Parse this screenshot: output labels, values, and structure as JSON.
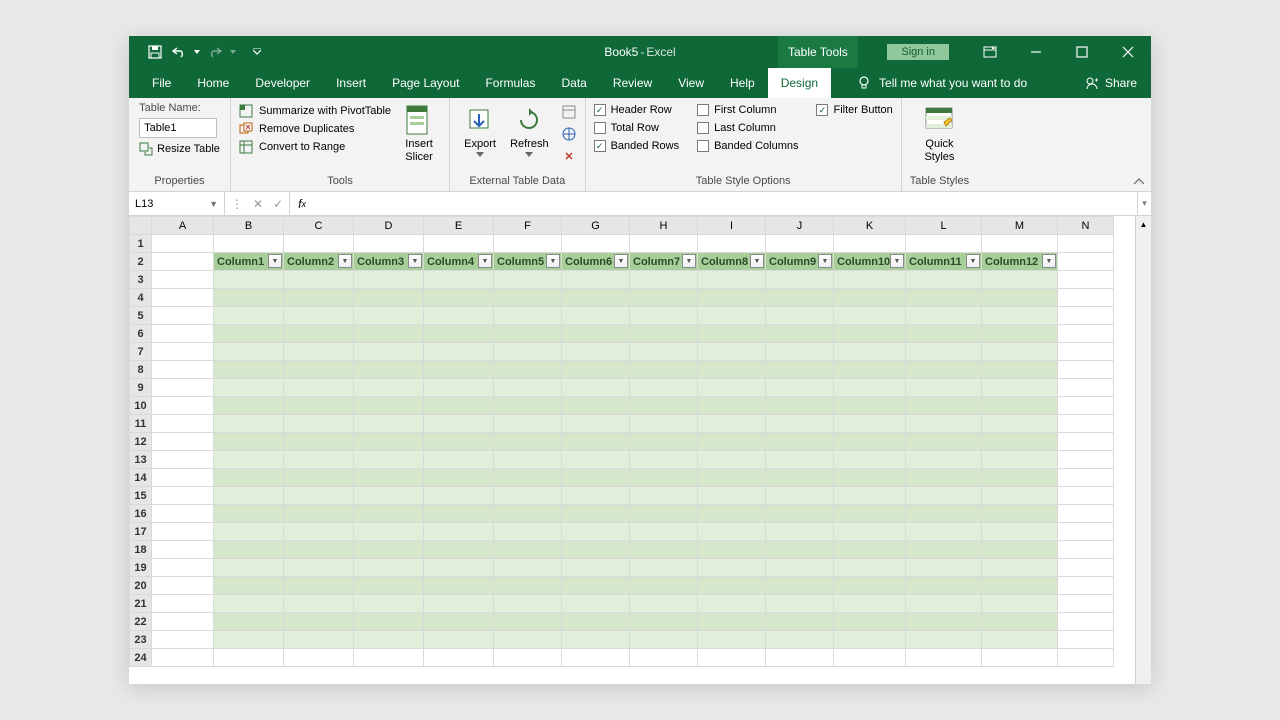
{
  "title": {
    "doc": "Book5",
    "sep": " - ",
    "app": "Excel"
  },
  "contextual_tab_group": "Table Tools",
  "signin": "Sign in",
  "tabs": [
    "File",
    "Home",
    "Developer",
    "Insert",
    "Page Layout",
    "Formulas",
    "Data",
    "Review",
    "View",
    "Help",
    "Design"
  ],
  "active_tab": "Design",
  "tellme": "Tell me what you want to do",
  "share": "Share",
  "ribbon": {
    "properties": {
      "label": "Properties",
      "table_name_label": "Table Name:",
      "table_name": "Table1",
      "resize": "Resize Table"
    },
    "tools": {
      "label": "Tools",
      "summarize": "Summarize with PivotTable",
      "remove_dup": "Remove Duplicates",
      "convert": "Convert to Range",
      "slicer": "Insert\nSlicer"
    },
    "external": {
      "label": "External Table Data",
      "export": "Export",
      "refresh": "Refresh"
    },
    "style_options": {
      "label": "Table Style Options",
      "header_row": "Header Row",
      "total_row": "Total Row",
      "banded_rows": "Banded Rows",
      "first_col": "First Column",
      "last_col": "Last Column",
      "banded_cols": "Banded Columns",
      "filter_btn": "Filter Button",
      "checked": {
        "header_row": true,
        "total_row": false,
        "banded_rows": true,
        "first_col": false,
        "last_col": false,
        "banded_cols": false,
        "filter_btn": true
      }
    },
    "styles": {
      "label": "Table Styles",
      "quick": "Quick\nStyles"
    }
  },
  "namebox": "L13",
  "formula": "",
  "columns": [
    "A",
    "B",
    "C",
    "D",
    "E",
    "F",
    "G",
    "H",
    "I",
    "J",
    "K",
    "L",
    "M",
    "N"
  ],
  "rows": [
    1,
    2,
    3,
    4,
    5,
    6,
    7,
    8,
    9,
    10,
    11,
    12,
    13,
    14,
    15,
    16,
    17,
    18,
    19,
    20,
    21,
    22,
    23,
    24
  ],
  "table_header_row": 2,
  "table_columns": [
    "Column1",
    "Column2",
    "Column3",
    "Column4",
    "Column5",
    "Column6",
    "Column7",
    "Column8",
    "Column9",
    "Column10",
    "Column11",
    "Column12"
  ],
  "table_first_col_index": 1,
  "table_last_row": 23
}
